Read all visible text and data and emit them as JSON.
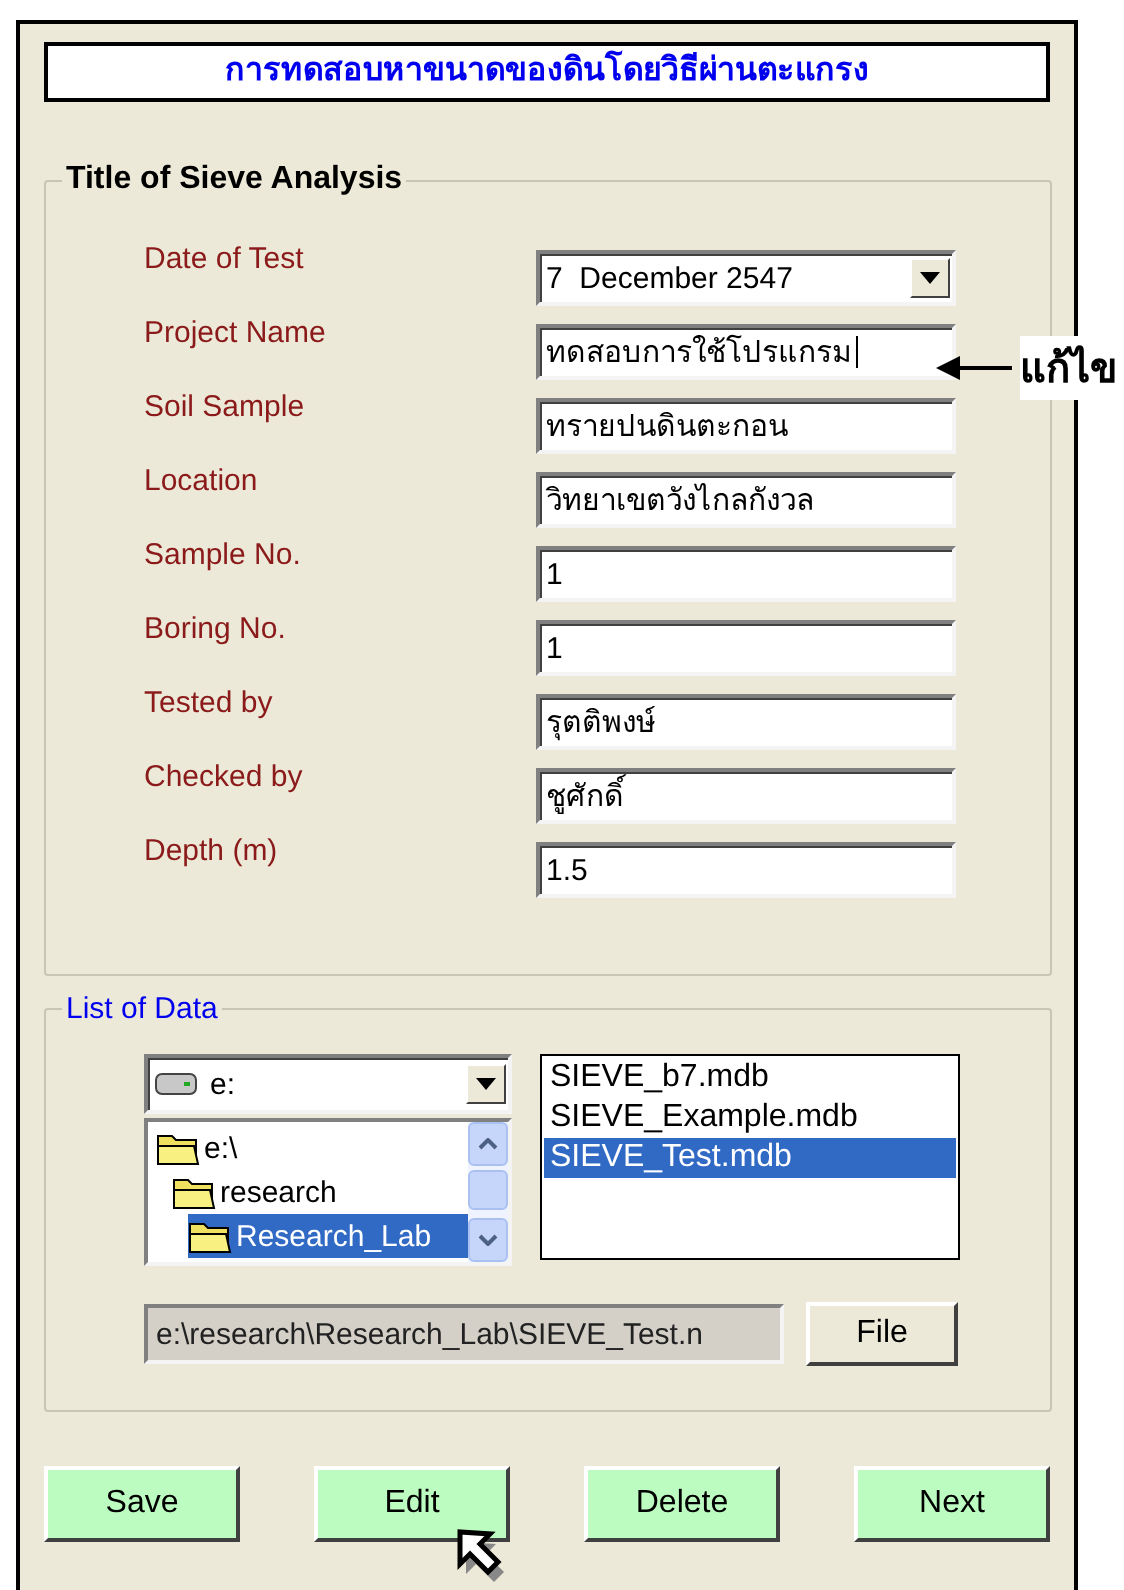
{
  "title": "การทดสอบหาขนาดของดินโดยวิธีผ่านตะแกรง",
  "details": {
    "legend": "Title of Sieve Analysis",
    "fields": [
      {
        "label": "Date of Test",
        "value": "7  December 2547",
        "kind": "dropdown",
        "focused": false
      },
      {
        "label": "Project Name",
        "value": "ทดสอบการใช้โปรแกรม",
        "kind": "text",
        "focused": true
      },
      {
        "label": "Soil Sample",
        "value": "ทรายปนดินตะกอน",
        "kind": "text",
        "focused": false
      },
      {
        "label": "Location",
        "value": "วิทยาเขตวังไกลกังวล",
        "kind": "text",
        "focused": false
      },
      {
        "label": "Sample No.",
        "value": "1",
        "kind": "text",
        "focused": false
      },
      {
        "label": "Boring No.",
        "value": "1",
        "kind": "text",
        "focused": false
      },
      {
        "label": "Tested by",
        "value": "รุตติพงษ์",
        "kind": "text",
        "focused": false
      },
      {
        "label": "Checked by",
        "value": "ชูศักดิ์",
        "kind": "text",
        "focused": false
      },
      {
        "label": "Depth (m)",
        "value": "1.5",
        "kind": "text",
        "focused": false
      }
    ]
  },
  "annotation": {
    "text": "แก้ไข"
  },
  "data_list": {
    "legend": "List of Data",
    "drive": "e:",
    "folders": [
      {
        "name": "e:\\",
        "selected": false,
        "children": [
          {
            "name": "research",
            "selected": false,
            "children": [
              {
                "name": "Research_Lab",
                "selected": true
              }
            ]
          }
        ]
      }
    ],
    "files": [
      {
        "name": "SIEVE_b7.mdb",
        "selected": false
      },
      {
        "name": "SIEVE_Example.mdb",
        "selected": false
      },
      {
        "name": "SIEVE_Test.mdb",
        "selected": true
      }
    ],
    "path": "e:\\research\\Research_Lab\\SIEVE_Test.n",
    "file_button": "File"
  },
  "buttons": [
    "Save",
    "Edit",
    "Delete",
    "Next"
  ]
}
